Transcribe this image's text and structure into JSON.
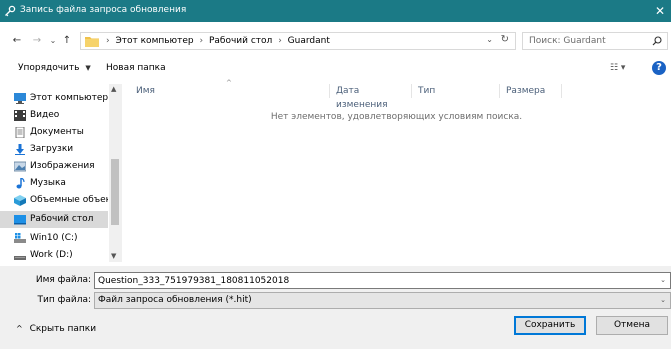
{
  "window": {
    "title": "Запись файла запроса обновления",
    "close_glyph": "✕"
  },
  "nav": {
    "back_glyph": "←",
    "forward_glyph": "→",
    "recent_glyph": "⌄",
    "up_glyph": "↑"
  },
  "address": {
    "crumbs": [
      "Этот компьютер",
      "Рабочий стол",
      "Guardant"
    ],
    "separator": "›",
    "dropdown_glyph": "⌄",
    "refresh_glyph": "↻"
  },
  "search": {
    "placeholder": "Поиск: Guardant"
  },
  "toolbar": {
    "organize_label": "Упорядочить",
    "organize_dd": "▼",
    "new_folder_label": "Новая папка",
    "view_glyph": "☷ ▾",
    "help_glyph": "?"
  },
  "sidebar": {
    "items": [
      {
        "label": "Этот компьютер",
        "icon": "computer-icon"
      },
      {
        "label": "Видео",
        "icon": "video-icon"
      },
      {
        "label": "Документы",
        "icon": "documents-icon"
      },
      {
        "label": "Загрузки",
        "icon": "downloads-icon"
      },
      {
        "label": "Изображения",
        "icon": "pictures-icon"
      },
      {
        "label": "Музыка",
        "icon": "music-icon"
      },
      {
        "label": "Объемные объекты",
        "icon": "3d-objects-icon"
      },
      {
        "label": "Рабочий стол",
        "icon": "desktop-icon",
        "selected": true
      },
      {
        "label": "Win10 (C:)",
        "icon": "drive-c-icon"
      },
      {
        "label": "Work (D:)",
        "icon": "drive-d-icon"
      }
    ],
    "scroll_up_glyph": "▲",
    "scroll_down_glyph": "▼"
  },
  "columns": {
    "name": "Имя",
    "date": "Дата изменения",
    "type": "Тип",
    "size": "Размера",
    "sort_glyph": "^"
  },
  "content": {
    "empty_message": "Нет элементов, удовлетворяющих условиям поиска."
  },
  "form": {
    "filename_label": "Имя файла:",
    "filename_value": "Question_333_751979381_180811052018",
    "filetype_label": "Тип файла:",
    "filetype_value": "Файл запроса обновления (*.hit)",
    "dropdown_glyph": "⌄"
  },
  "footer": {
    "hide_folders_chev": "^",
    "hide_folders_label": "Скрыть папки",
    "save_label": "Сохранить",
    "cancel_label": "Отмена"
  },
  "colors": {
    "titlebar": "#1b7a86",
    "accent": "#0078d7",
    "help": "#1a62c4"
  }
}
